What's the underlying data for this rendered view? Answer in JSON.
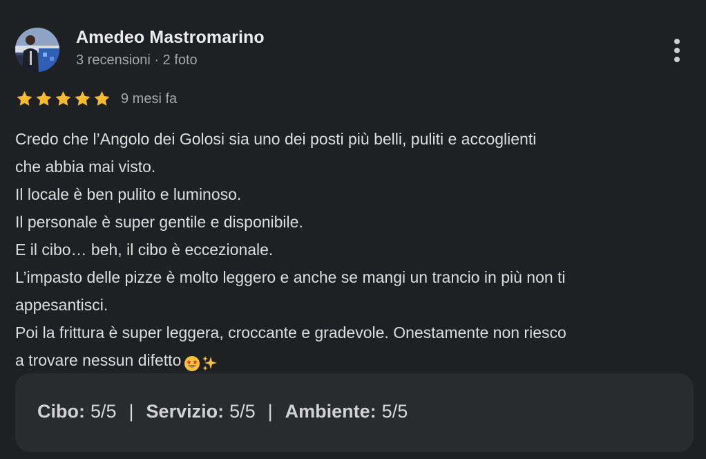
{
  "reviewer": {
    "name": "Amedeo Mastromarino",
    "meta": "3 recensioni · 2 foto"
  },
  "rating": {
    "stars": 5,
    "max": 5,
    "time_ago": "9 mesi fa",
    "star_color": "#f6bb2f"
  },
  "review": {
    "lines": [
      "Credo che l’Angolo dei Golosi sia uno dei posti più belli, puliti e accoglienti",
      "che abbia mai visto.",
      "Il locale è ben pulito e luminoso.",
      "Il personale è super gentile e disponibile.",
      "E il cibo… beh, il cibo è eccezionale.",
      "L’impasto delle pizze è molto leggero e anche se mangi un trancio in più non ti",
      "appesantisci.",
      "Poi la frittura è super leggera, croccante e gradevole. Onestamente non riesco",
      "a trovare nessun difetto"
    ],
    "trailing_emojis": [
      "star-struck-emoji",
      "sparkles-emoji"
    ]
  },
  "sub_ratings": [
    {
      "label": "Cibo:",
      "value": "5/5"
    },
    {
      "label": "Servizio:",
      "value": "5/5"
    },
    {
      "label": "Ambiente:",
      "value": "5/5"
    }
  ],
  "separator": "|",
  "colors": {
    "background": "#1f2023",
    "panel": "#2a2b2f",
    "text": "#dedede",
    "muted": "#a6a7ab"
  }
}
